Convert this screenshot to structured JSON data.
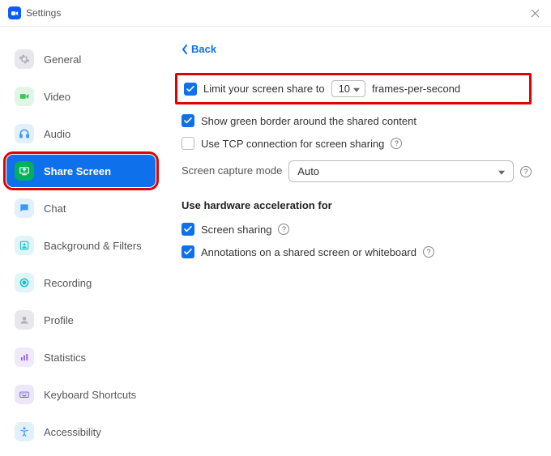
{
  "window": {
    "title": "Settings"
  },
  "sidebar": {
    "items": [
      {
        "label": "General",
        "icon_bg": "#E8E8EC",
        "icon_fg": "#B0B0B8"
      },
      {
        "label": "Video",
        "icon_bg": "#E2F6E7",
        "icon_fg": "#3BC55C"
      },
      {
        "label": "Audio",
        "icon_bg": "#E2F0FB",
        "icon_fg": "#3D98F4"
      },
      {
        "label": "Share Screen",
        "icon_bg": "#00B05C",
        "icon_fg": "#FFFFFF"
      },
      {
        "label": "Chat",
        "icon_bg": "#E2F0FB",
        "icon_fg": "#3D98F4"
      },
      {
        "label": "Background & Filters",
        "icon_bg": "#E0F5F7",
        "icon_fg": "#18C0D0"
      },
      {
        "label": "Recording",
        "icon_bg": "#E0F5F7",
        "icon_fg": "#18C0D0"
      },
      {
        "label": "Profile",
        "icon_bg": "#E8E8EC",
        "icon_fg": "#B0B0B8"
      },
      {
        "label": "Statistics",
        "icon_bg": "#F0E8FB",
        "icon_fg": "#9B59E8"
      },
      {
        "label": "Keyboard Shortcuts",
        "icon_bg": "#ECE7F9",
        "icon_fg": "#7560D9"
      },
      {
        "label": "Accessibility",
        "icon_bg": "#E2F0FB",
        "icon_fg": "#3D98F4"
      }
    ]
  },
  "content": {
    "back": "Back",
    "limit_fps": {
      "label_before": "Limit your screen share to",
      "value": "10",
      "label_after": "frames-per-second"
    },
    "green_border_label": "Show green border around the shared content",
    "tcp_label": "Use TCP connection for screen sharing",
    "capture_mode_label": "Screen capture mode",
    "capture_mode_value": "Auto",
    "hw_header": "Use hardware acceleration for",
    "hw_screen_share": "Screen sharing",
    "hw_annotations": "Annotations on a shared screen or whiteboard"
  }
}
